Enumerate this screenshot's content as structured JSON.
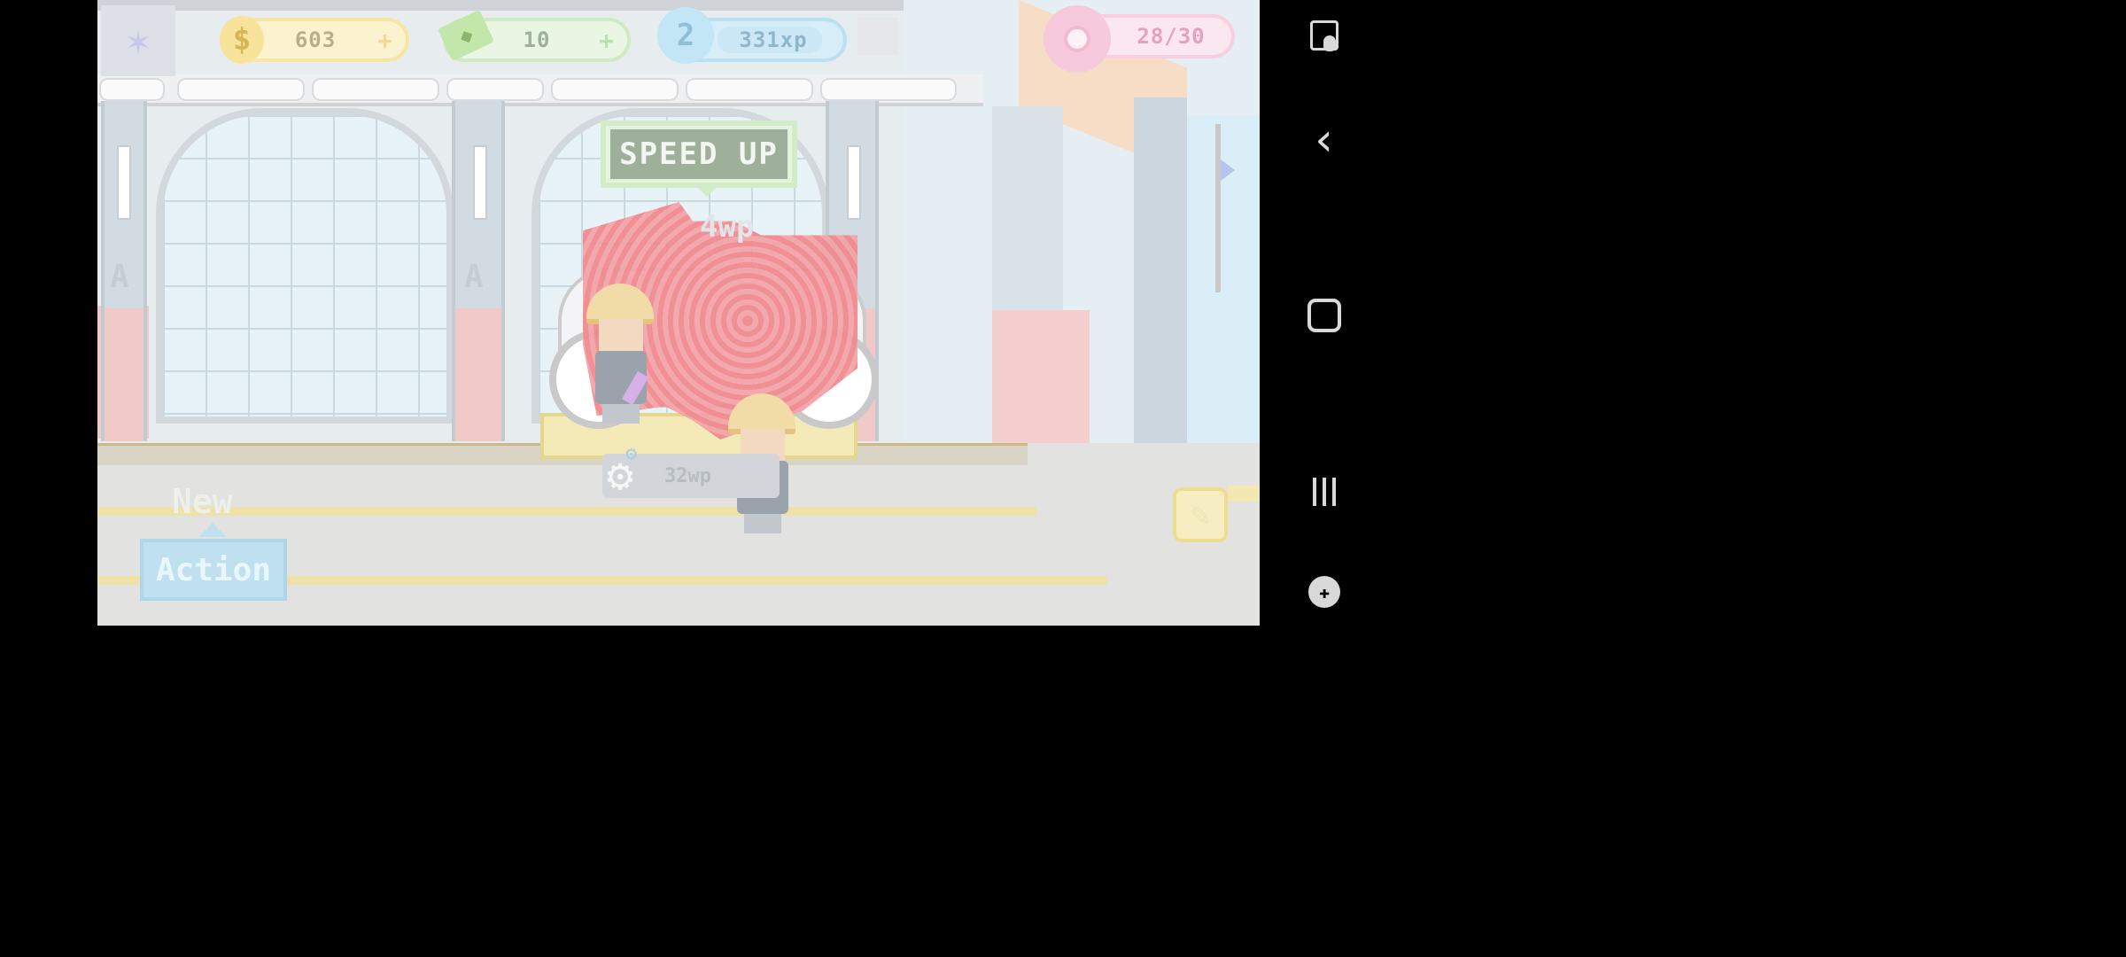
{
  "hud": {
    "coins": "603",
    "cash": "10",
    "level": "2",
    "xp": "331xp",
    "donuts": "28/30",
    "plus": "+"
  },
  "scene": {
    "speed_up_label": "SPEED UP",
    "top_wp": "4wp",
    "worker_wp": "32wp",
    "wall_letter": "A"
  },
  "actions": {
    "new_label": "New",
    "action_label": "Action"
  },
  "icons": {
    "coin": "coin-icon",
    "cash": "cash-icon",
    "xp": "plane-xp-icon",
    "donut": "donut-icon",
    "gear": "gear-icon",
    "tool": "wrench-icon"
  },
  "colors": {
    "coin": "#f7e39a",
    "cash": "#c3e6ab",
    "xp": "#c2e6f6",
    "donut": "#f7c9dd",
    "speed_up": "#9fb09a",
    "action": "#bfe1ef"
  }
}
